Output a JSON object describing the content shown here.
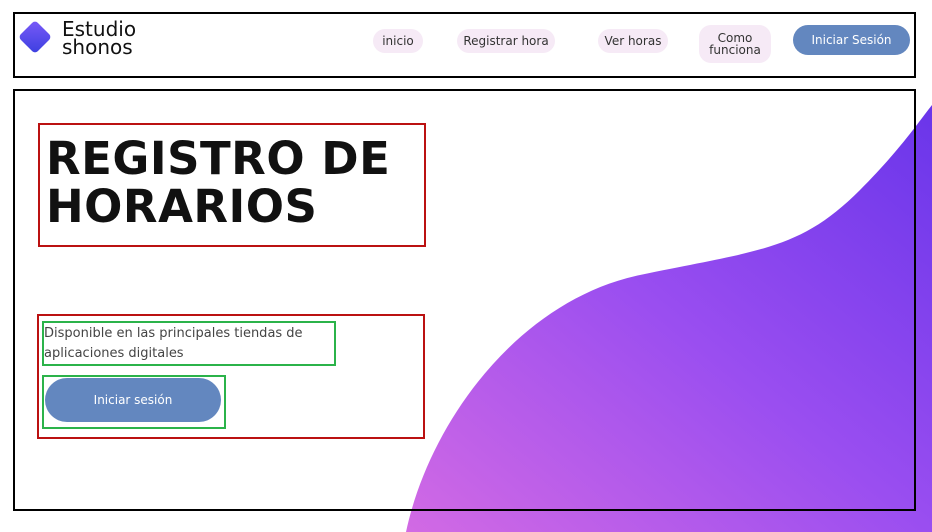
{
  "brand": {
    "line1": "Estudio",
    "line2": "shonos"
  },
  "nav": {
    "inicio": "inicio",
    "registrar": "Registrar hora",
    "ver_horas": "Ver horas",
    "como_line1": "Como",
    "como_line2": "funciona",
    "login": "Iniciar Sesión"
  },
  "hero": {
    "title_line1": "REGISTRO DE",
    "title_line2": "HORARIOS",
    "subtitle": "Disponible en las principales tiendas de aplicaciones digitales",
    "button": "Iniciar sesión"
  },
  "colors": {
    "accent_button": "#6387bf",
    "nav_pill": "#f6eaf6",
    "gradient_start": "#c56be6",
    "gradient_end": "#6a35ea"
  }
}
